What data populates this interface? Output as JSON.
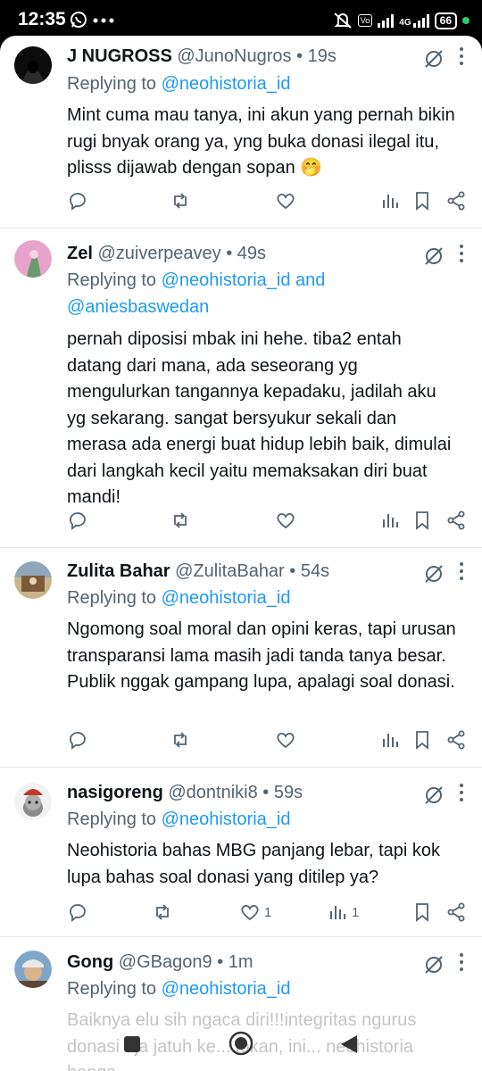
{
  "status_bar": {
    "time": "12:35",
    "left_icons": [
      "whatsapp-icon",
      "more-dots-icon"
    ],
    "right_icons": [
      "mute-icon",
      "volte-icon",
      "signal-icon",
      "4g-signal-icon",
      "battery-icon"
    ],
    "network": "4G",
    "battery": "66",
    "accent": "#2ecc71"
  },
  "colors": {
    "link": "#1d9bf0",
    "muted": "#536471",
    "text": "#0f1419"
  },
  "tweets": [
    {
      "name": "J NUGROSS",
      "handle": "@JunoNugros",
      "time": "• 19s",
      "replying_prefix": "Replying to",
      "mention1": "@neohistoria_id",
      "text": "Mint cuma mau tanya, ini akun yang pernah bikin rugi bnyak orang ya, yng buka donasi ilegal itu, plisss dijawab dengan sopan 🤭",
      "likes": "",
      "views": ""
    },
    {
      "name": "Zel",
      "handle": "@zuiverpeavey",
      "time": "• 49s",
      "replying_prefix": "Replying to",
      "mention1": "@neohistoria_id and",
      "mention2": "@aniesbaswedan",
      "text": "pernah diposisi mbak ini hehe. tiba2 entah datang dari mana, ada seseorang yg mengulurkan tangannya kepadaku, jadilah aku yg sekarang. sangat bersyukur sekali dan merasa ada energi buat hidup lebih baik, dimulai dari langkah kecil yaitu memaksakan diri buat mandi!",
      "likes": "",
      "views": ""
    },
    {
      "name": "Zulita Bahar",
      "handle": "@ZulitaBahar",
      "time": "• 54s",
      "replying_prefix": "Replying to",
      "mention1": "@neohistoria_id",
      "text": "Ngomong soal moral dan opini keras, tapi urusan transparansi lama masih jadi tanda tanya besar. Publik nggak gampang lupa, apalagi soal donasi.",
      "likes": "",
      "views": ""
    },
    {
      "name": "nasigoreng",
      "handle": "@dontniki8",
      "time": "• 59s",
      "replying_prefix": "Replying to",
      "mention1": "@neohistoria_id",
      "text": "Neohistoria bahas MBG panjang lebar, tapi kok lupa bahas soal donasi yang ditilep ya?",
      "likes": "1",
      "views": "1"
    },
    {
      "name": "Gong",
      "handle": "@GBagon9",
      "time": "• 1m",
      "replying_prefix": "Replying to",
      "mention1": "@neohistoria_id",
      "text": "Baiknya elu sih ngaca diri!!!integritas ngurus donasi aja jatuh ke... lokan, ini... neohistoria bangs...",
      "likes": "",
      "views": ""
    }
  ],
  "nav_bar": {
    "buttons": [
      "recents-button",
      "home-button",
      "back-button"
    ]
  }
}
